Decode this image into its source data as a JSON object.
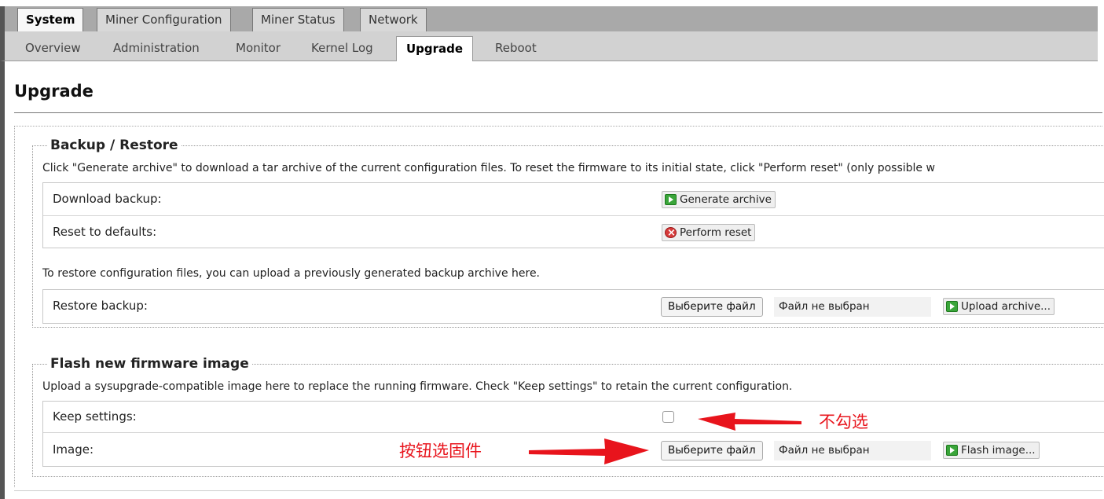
{
  "top_tabs": [
    {
      "label": "System",
      "active": true
    },
    {
      "label": "Miner Configuration",
      "active": false
    },
    {
      "label": "Miner Status",
      "active": false
    },
    {
      "label": "Network",
      "active": false
    }
  ],
  "sub_tabs": [
    {
      "label": "Overview",
      "active": false
    },
    {
      "label": "Administration",
      "active": false
    },
    {
      "label": "Monitor",
      "active": false
    },
    {
      "label": "Kernel Log",
      "active": false
    },
    {
      "label": "Upgrade",
      "active": true
    },
    {
      "label": "Reboot",
      "active": false
    }
  ],
  "page": {
    "title": "Upgrade"
  },
  "backup": {
    "legend": "Backup / Restore",
    "description": "Click \"Generate archive\" to download a tar archive of the current configuration files. To reset the firmware to its initial state, click \"Perform reset\" (only possible w",
    "rows": [
      {
        "label": "Download backup:",
        "button": "Generate archive",
        "icon": "green-arrow-icon"
      },
      {
        "label": "Reset to defaults:",
        "button": "Perform reset",
        "icon": "red-x-icon"
      }
    ],
    "restore_text": "To restore configuration files, you can upload a previously generated backup archive here.",
    "restore": {
      "label": "Restore backup:",
      "file_button": "Выберите файл",
      "file_status": "Файл не выбран",
      "upload_button": "Upload archive..."
    }
  },
  "flash": {
    "legend": "Flash new firmware image",
    "description": "Upload a sysupgrade-compatible image here to replace the running firmware. Check \"Keep settings\" to retain the current configuration.",
    "keep_settings": {
      "label": "Keep settings:",
      "checked": false
    },
    "image": {
      "label": "Image:",
      "file_button": "Выберите файл",
      "file_status": "Файл не выбран",
      "flash_button": "Flash image..."
    }
  },
  "annotations": {
    "uncheck": "不勾选",
    "choose_firmware": "按钮选固件",
    "color": "#e8141c"
  }
}
